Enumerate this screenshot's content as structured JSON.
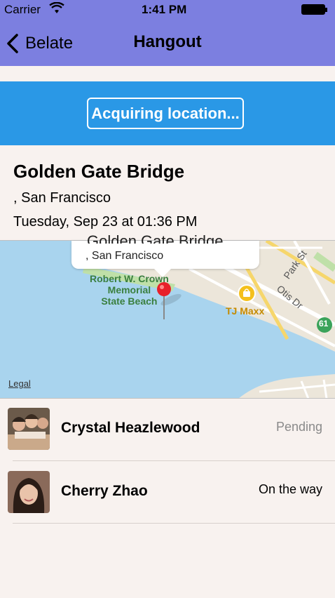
{
  "status_bar": {
    "carrier": "Carrier",
    "time": "1:41 PM"
  },
  "nav": {
    "back_label": "Belate",
    "title": "Hangout"
  },
  "banner": {
    "button_label": "Acquiring location..."
  },
  "place": {
    "title": "Golden Gate Bridge",
    "city": ", San Francisco",
    "datetime": "Tuesday, Sep 23 at 01:36 PM"
  },
  "map": {
    "callout_title": "Golden Gate Bridge",
    "callout_subtitle": ", San Francisco",
    "legal": "Legal",
    "park_label_1": "Robert W. Crown",
    "park_label_2": "Memorial",
    "park_label_3": "State Beach",
    "store_label": "TJ Maxx",
    "street_1": "Park St",
    "street_2": "Otis Dr",
    "route_badge": "61"
  },
  "attendees": [
    {
      "name": "Crystal Heazlewood",
      "status": "Pending",
      "status_color": "#8a8a8a"
    },
    {
      "name": "Cherry Zhao",
      "status": "On the way",
      "status_color": "#000000"
    }
  ],
  "colors": {
    "nav_bg": "#7c7fe0",
    "banner_bg": "#2a98e6",
    "page_bg": "#f8f2ef",
    "pin": "#e8202a"
  }
}
